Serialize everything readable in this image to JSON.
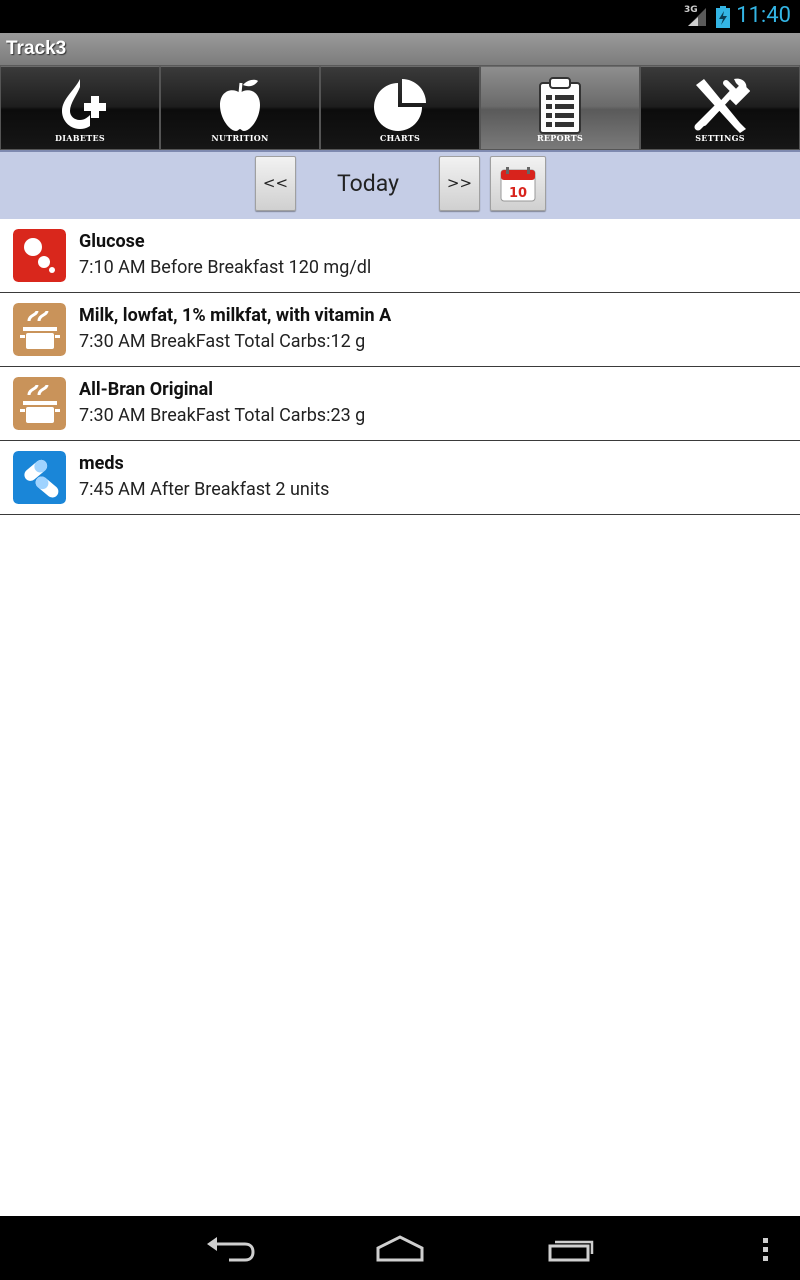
{
  "status_bar": {
    "network": "3G",
    "time": "11:40",
    "accent": "#33b5e5"
  },
  "app": {
    "title": "Track3"
  },
  "tabs": [
    {
      "label": "DIABETES",
      "icon": "diabetes-plus-icon",
      "active": false
    },
    {
      "label": "NUTRITION",
      "icon": "apple-icon",
      "active": false
    },
    {
      "label": "CHARTS",
      "icon": "pie-chart-icon",
      "active": false
    },
    {
      "label": "REPORTS",
      "icon": "clipboard-icon",
      "active": true
    },
    {
      "label": "SETTINGS",
      "icon": "tools-icon",
      "active": false
    }
  ],
  "date_nav": {
    "prev_label": "<<",
    "next_label": ">>",
    "date_label": "Today",
    "calendar_day": "10"
  },
  "entries": [
    {
      "title": "Glucose",
      "detail": "7:10 AM Before Breakfast 120 mg/dl",
      "icon": "glucose-drops-icon",
      "color": "#d9271c"
    },
    {
      "title": "Milk, lowfat, 1% milkfat, with vitamin A",
      "detail": "7:30 AM BreakFast Total Carbs:12 g",
      "icon": "cooking-pot-icon",
      "color": "#c9935a"
    },
    {
      "title": "All-Bran Original",
      "detail": "7:30 AM BreakFast Total Carbs:23 g",
      "icon": "cooking-pot-icon",
      "color": "#c9935a"
    },
    {
      "title": "meds",
      "detail": "7:45 AM After Breakfast 2 units",
      "icon": "pills-icon",
      "color": "#1a86d8"
    }
  ],
  "system_nav": {
    "keys": [
      "back-icon",
      "home-icon",
      "recent-apps-icon",
      "menu-icon"
    ]
  }
}
